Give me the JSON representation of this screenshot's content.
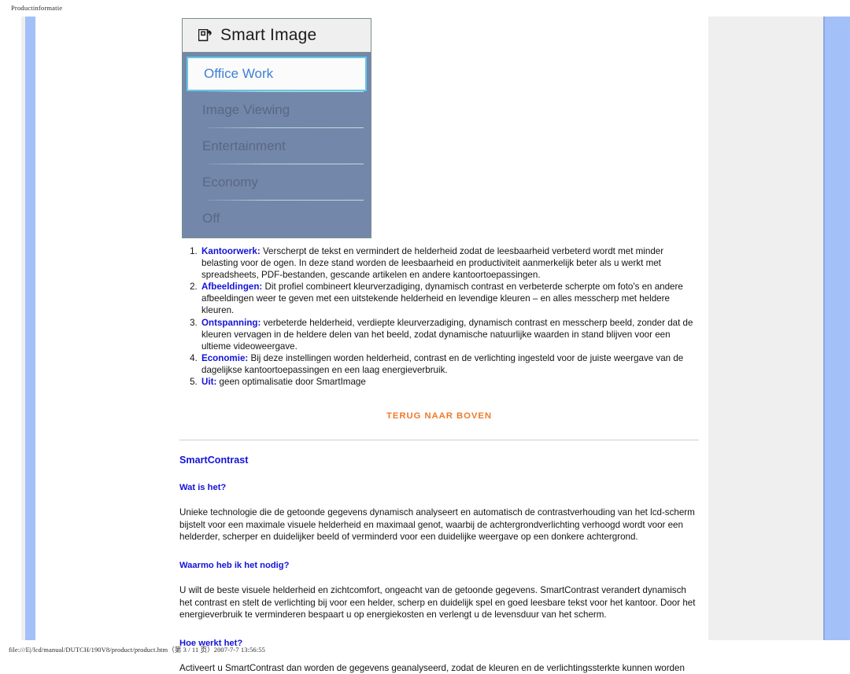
{
  "print": {
    "header": "Productinformatie",
    "footer": "file:///E|/lcd/manual/DUTCH/190V8/product/product.htm（第 3 / 11 页）2007-7-7 13:56:55"
  },
  "osd": {
    "title": "Smart Image",
    "icon": "smart-image-icon",
    "items": [
      {
        "label": "Office Work",
        "selected": true
      },
      {
        "label": "Image Viewing",
        "selected": false
      },
      {
        "label": "Entertainment",
        "selected": false
      },
      {
        "label": "Economy",
        "selected": false
      },
      {
        "label": "Off",
        "selected": false
      }
    ]
  },
  "profiles": [
    {
      "term": "Kantoorwerk:",
      "text": " Verscherpt de tekst en vermindert de helderheid zodat de leesbaarheid verbeterd wordt met minder belasting voor de ogen. In deze stand worden de leesbaarheid en productiviteit aanmerkelijk beter als u werkt met spreadsheets, PDF-bestanden, gescande artikelen en andere kantoortoepassingen."
    },
    {
      "term": "Afbeeldingen:",
      "text": " Dit profiel combineert kleurverzadiging, dynamisch contrast en verbeterde scherpte om foto's en andere afbeeldingen weer te geven met een uitstekende helderheid en levendige kleuren – en alles messcherp met heldere kleuren."
    },
    {
      "term": "Ontspanning:",
      "text": " verbeterde helderheid, verdiepte kleurverzadiging, dynamisch contrast en messcherp beeld, zonder dat de kleuren vervagen in de heldere delen van het beeld, zodat dynamische natuurlijke waarden in stand blijven voor een ultieme videoweergave."
    },
    {
      "term": "Economie:",
      "text": " Bij deze instellingen worden helderheid, contrast en de verlichting ingesteld voor de juiste weergave van de dagelijkse kantoortoepassingen en een laag energieverbruik."
    },
    {
      "term": "Uit:",
      "text": " geen optimalisatie door SmartImage"
    }
  ],
  "back_to_top": "TERUG NAAR BOVEN",
  "smartcontrast": {
    "title": "SmartContrast",
    "q1": {
      "heading": "Wat is het?",
      "text": "Unieke technologie die de getoonde gegevens dynamisch analyseert en automatisch de contrastverhouding van het lcd-scherm bijstelt voor een maximale visuele helderheid en maximaal genot, waarbij de achtergrondverlichting verhoogd wordt voor een helderder, scherper en duidelijker beeld of verminderd voor een duidelijke weergave op een donkere achtergrond."
    },
    "q2": {
      "heading": "Waarmo heb ik het nodig?",
      "text": "U wilt de beste visuele helderheid en zichtcomfort, ongeacht van de getoonde gegevens. SmartContrast verandert dynamisch het contrast en stelt de verlichting bij voor een helder, scherp en duidelijk spel en goed leesbare tekst voor het kantoor. Door het energieverbruik te verminderen bespaart u op energiekosten en verlengt u de levensduur van het scherm."
    },
    "q3": {
      "heading": "Hoe werkt het?",
      "text": "Activeert u SmartContrast dan worden de gegevens geanalyseerd, zodat de kleuren en de verlichtingssterkte kunnen worden"
    }
  },
  "colors": {
    "link_orange": "#f07a2a",
    "heading_blue": "#1313d8",
    "osd_panel": "#7387aa",
    "osd_selected_border": "#63c8e8",
    "page_blue": "#a3c0f8"
  }
}
